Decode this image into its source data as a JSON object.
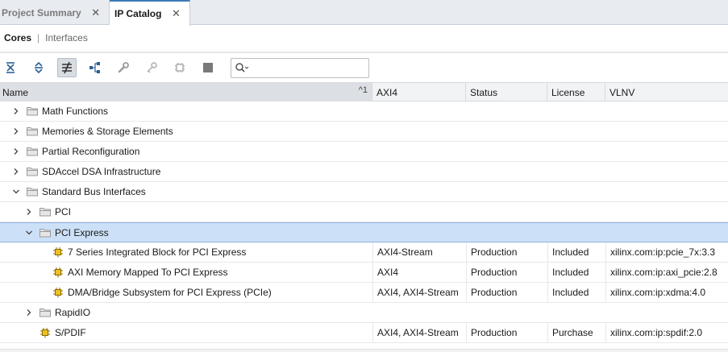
{
  "tabs": [
    {
      "label": "Project Summary",
      "active": false
    },
    {
      "label": "IP Catalog",
      "active": true
    }
  ],
  "subtabs": {
    "cores": "Cores",
    "separator": "|",
    "interfaces": "Interfaces"
  },
  "toolbar": {
    "buttons": [
      "collapse-all-icon",
      "expand-all-icon",
      "filter-icon",
      "hierarchy-icon",
      "wrench-icon",
      "key-icon",
      "chip-icon",
      "stop-icon"
    ],
    "search_placeholder": ""
  },
  "columns": {
    "name": "Name",
    "sort": "^1",
    "axi4": "AXI4",
    "status": "Status",
    "license": "License",
    "vlnv": "VLNV"
  },
  "rows": [
    {
      "type": "folder",
      "name": "Math Functions",
      "expanded": false,
      "level": 0
    },
    {
      "type": "folder",
      "name": "Memories & Storage Elements",
      "expanded": false,
      "level": 0
    },
    {
      "type": "folder",
      "name": "Partial Reconfiguration",
      "expanded": false,
      "level": 0
    },
    {
      "type": "folder",
      "name": "SDAccel DSA Infrastructure",
      "expanded": false,
      "level": 0
    },
    {
      "type": "folder",
      "name": "Standard Bus Interfaces",
      "expanded": true,
      "level": 0
    },
    {
      "type": "folder",
      "name": "PCI",
      "expanded": false,
      "level": 1
    },
    {
      "type": "folder",
      "name": "PCI Express",
      "expanded": true,
      "level": 1,
      "selected": true
    },
    {
      "type": "ip",
      "name": "7 Series Integrated Block for PCI Express",
      "level": 2,
      "axi4": "AXI4-Stream",
      "status": "Production",
      "license": "Included",
      "vlnv": "xilinx.com:ip:pcie_7x:3.3"
    },
    {
      "type": "ip",
      "name": "AXI Memory Mapped To PCI Express",
      "level": 2,
      "axi4": "AXI4",
      "status": "Production",
      "license": "Included",
      "vlnv": "xilinx.com:ip:axi_pcie:2.8"
    },
    {
      "type": "ip",
      "name": "DMA/Bridge Subsystem for PCI Express (PCIe)",
      "level": 2,
      "axi4": "AXI4, AXI4-Stream",
      "status": "Production",
      "license": "Included",
      "vlnv": "xilinx.com:ip:xdma:4.0"
    },
    {
      "type": "folder",
      "name": "RapidIO",
      "expanded": false,
      "level": 1
    },
    {
      "type": "ip",
      "name": "S/PDIF",
      "level": 1,
      "axi4": "AXI4, AXI4-Stream",
      "status": "Production",
      "license": "Purchase",
      "vlnv": "xilinx.com:ip:spdif:2.0"
    }
  ],
  "colors": {
    "accent": "#3d7ab8",
    "selection": "#cce0f7",
    "ip_icon": "#f0c020"
  }
}
